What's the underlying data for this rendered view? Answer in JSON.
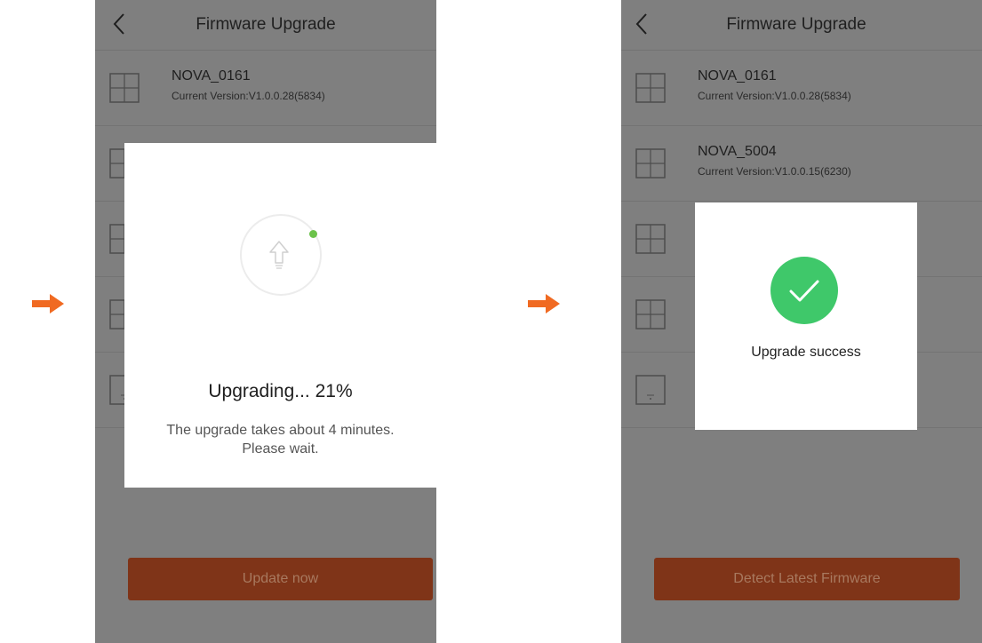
{
  "colors": {
    "accent": "#f06a22",
    "overlay": "#7f7f7f",
    "button_dim": "#7f3418",
    "progress_dot": "#6bc24a",
    "success": "#3fc86a"
  },
  "screen1": {
    "title": "Firmware Upgrade",
    "device": {
      "name": "NOVA_0161",
      "version": "Current Version:V1.0.0.28(5834)"
    },
    "modal": {
      "title": "Upgrading... 21%",
      "progress_percent": 21,
      "message_line1": "The upgrade takes about 4 minutes.",
      "message_line2": "Please wait."
    },
    "button_label": "Update now"
  },
  "screen2": {
    "title": "Firmware Upgrade",
    "devices": [
      {
        "name": "NOVA_0161",
        "version": "Current Version:V1.0.0.28(5834)"
      },
      {
        "name": "NOVA_5004",
        "version": "Current Version:V1.0.0.15(6230)"
      }
    ],
    "modal": {
      "message": "Upgrade success"
    },
    "button_label": "Detect Latest Firmware"
  }
}
